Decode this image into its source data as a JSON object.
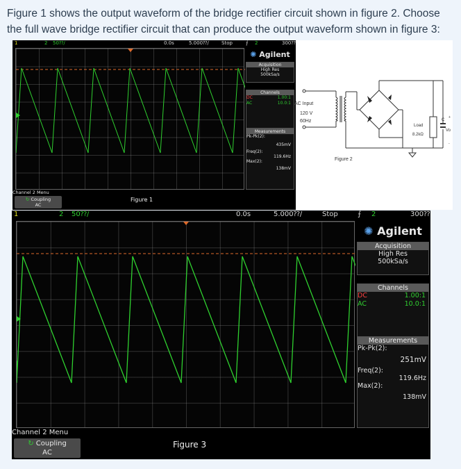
{
  "question": "Figure 1 shows the output waveform of the bridge rectifier circuit shown in figure 2. Choose the full wave bridge rectifier circuit that can produce the output waveform shown in figure 3:",
  "scope1": {
    "ch1": "1",
    "ch2": "2",
    "volts": "50⁇/",
    "time_offset": "0.0s",
    "time_div": "5.000⁇/",
    "run_state": "Stop",
    "trig_sym": "⨍",
    "trig_ch": "2",
    "trig_level": "300⁇",
    "brand": "Agilent",
    "acq_header": "Acquisition",
    "acq_mode": "High Res",
    "acq_rate": "500kSa/s",
    "channels_header": "Channels",
    "coupling_dc": "DC",
    "coupling_ac": "AC",
    "probe_ratio": "1.00:1",
    "probe_ratio2": "10.0:1",
    "meas_header": "Measurements",
    "pkpk_label": "Pk-Pk(2):",
    "pkpk_value": "435mV",
    "freq_label": "Freq(2):",
    "freq_value": "119.6Hz",
    "max_label": "Max(2):",
    "max_value": "138mV",
    "menu_title": "Channel 2 Menu",
    "coupling_label": "Coupling",
    "coupling_value": "AC",
    "caption": "Figure 1"
  },
  "figure2": {
    "ac_input": "AC Input",
    "voltage": "120 V",
    "frequency": "60Hz",
    "load": "Load",
    "resistance": "8.2kΩ",
    "cap": "C",
    "vo": "Vo",
    "plus": "+",
    "minus": "-",
    "caption": "Figure 2"
  },
  "scope3": {
    "ch1": "1",
    "ch2": "2",
    "volts": "50⁇/",
    "time_offset": "0.0s",
    "time_div": "5.000⁇/",
    "run_state": "Stop",
    "trig_sym": "⨍",
    "trig_ch": "2",
    "trig_level": "300⁇",
    "brand": "Agilent",
    "acq_header": "Acquisition",
    "acq_mode": "High Res",
    "acq_rate": "500kSa/s",
    "channels_header": "Channels",
    "coupling_dc": "DC",
    "coupling_ac": "AC",
    "probe_ratio": "1.00:1",
    "probe_ratio2": "10.0:1",
    "meas_header": "Measurements",
    "pkpk_label": "Pk-Pk(2):",
    "pkpk_value": "251mV",
    "freq_label": "Freq(2):",
    "freq_value": "119.6Hz",
    "max_label": "Max(2):",
    "max_value": "138mV",
    "menu_title": "Channel 2 Menu",
    "coupling_label": "Coupling",
    "coupling_value": "AC",
    "caption": "Figure 3"
  },
  "colors": {
    "trace": "#2fd12f",
    "ref_line": "#e06a2a",
    "dc": "#ff4040"
  }
}
